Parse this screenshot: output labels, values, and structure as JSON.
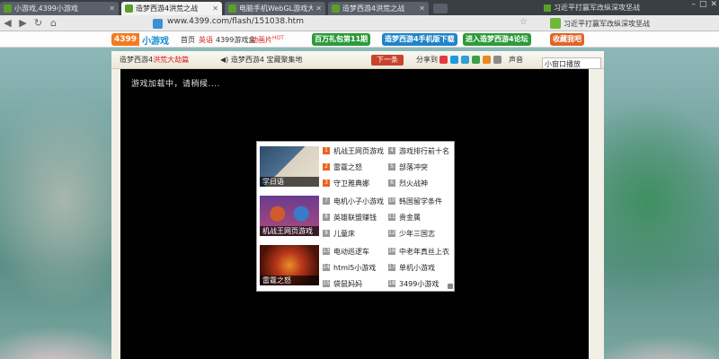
{
  "browser": {
    "tabs": [
      {
        "title": "小游戏,4399小游戏",
        "active": false
      },
      {
        "title": "造梦西游4洪荒之战",
        "active": true
      },
      {
        "title": "电脑手机WebGL游戏大全",
        "active": false
      },
      {
        "title": "造梦西游4洪荒之战",
        "active": false
      }
    ],
    "headline": "习近平打赢军改纵深攻坚战",
    "url": "www.4399.com/flash/151038.htm"
  },
  "site": {
    "logo_num": "4399",
    "logo_text": "小游戏",
    "nav": [
      "首页",
      "英语",
      "4399游戏盒",
      "动画片"
    ],
    "hot_badge": "HOT",
    "buttons": [
      {
        "label": "百万礼包第11期",
        "color": "#2d9b3a"
      },
      {
        "label": "造梦西游4手机版下载",
        "color": "#1f84c9"
      },
      {
        "label": "进入造梦西游4论坛",
        "color": "#2d9b3a"
      },
      {
        "label": "收藏我吧",
        "color": "#e0662a"
      }
    ]
  },
  "game": {
    "title": "造梦西游4",
    "subtitle": "洪荒大劫篇",
    "notice": "造梦西游4 宝藏聚集地",
    "next": "下一条",
    "share": "分享到",
    "sound": "声音",
    "mini_window": "小窗口播放",
    "loading": "游戏加载中，请稍候...."
  },
  "ad": {
    "thumbs": [
      {
        "caption": "学日语"
      },
      {
        "caption": "机战王网页游戏"
      },
      {
        "caption": "雷霆之怒"
      }
    ],
    "left_list": [
      {
        "rank": "1",
        "name": "机战王网页游戏"
      },
      {
        "rank": "2",
        "name": "雷霆之怒"
      },
      {
        "rank": "3",
        "name": "守卫雅典娜"
      },
      {
        "rank": "7",
        "name": "电机小子小游戏"
      },
      {
        "rank": "8",
        "name": "英雄联盟赚钱"
      },
      {
        "rank": "9",
        "name": "儿童床"
      },
      {
        "rank": "13",
        "name": "电动巡逻车"
      },
      {
        "rank": "14",
        "name": "html5小游戏"
      },
      {
        "rank": "15",
        "name": "袋鼠妈妈"
      }
    ],
    "right_list": [
      {
        "rank": "4",
        "name": "游戏排行前十名"
      },
      {
        "rank": "5",
        "name": "部落冲突"
      },
      {
        "rank": "6",
        "name": "烈火战神"
      },
      {
        "rank": "10",
        "name": "韩国留学条件"
      },
      {
        "rank": "11",
        "name": "贵金属"
      },
      {
        "rank": "12",
        "name": "少年三国志"
      },
      {
        "rank": "16",
        "name": "中老年真丝上衣"
      },
      {
        "rank": "17",
        "name": "单机小游戏"
      },
      {
        "rank": "18",
        "name": "3499小游戏"
      }
    ]
  }
}
